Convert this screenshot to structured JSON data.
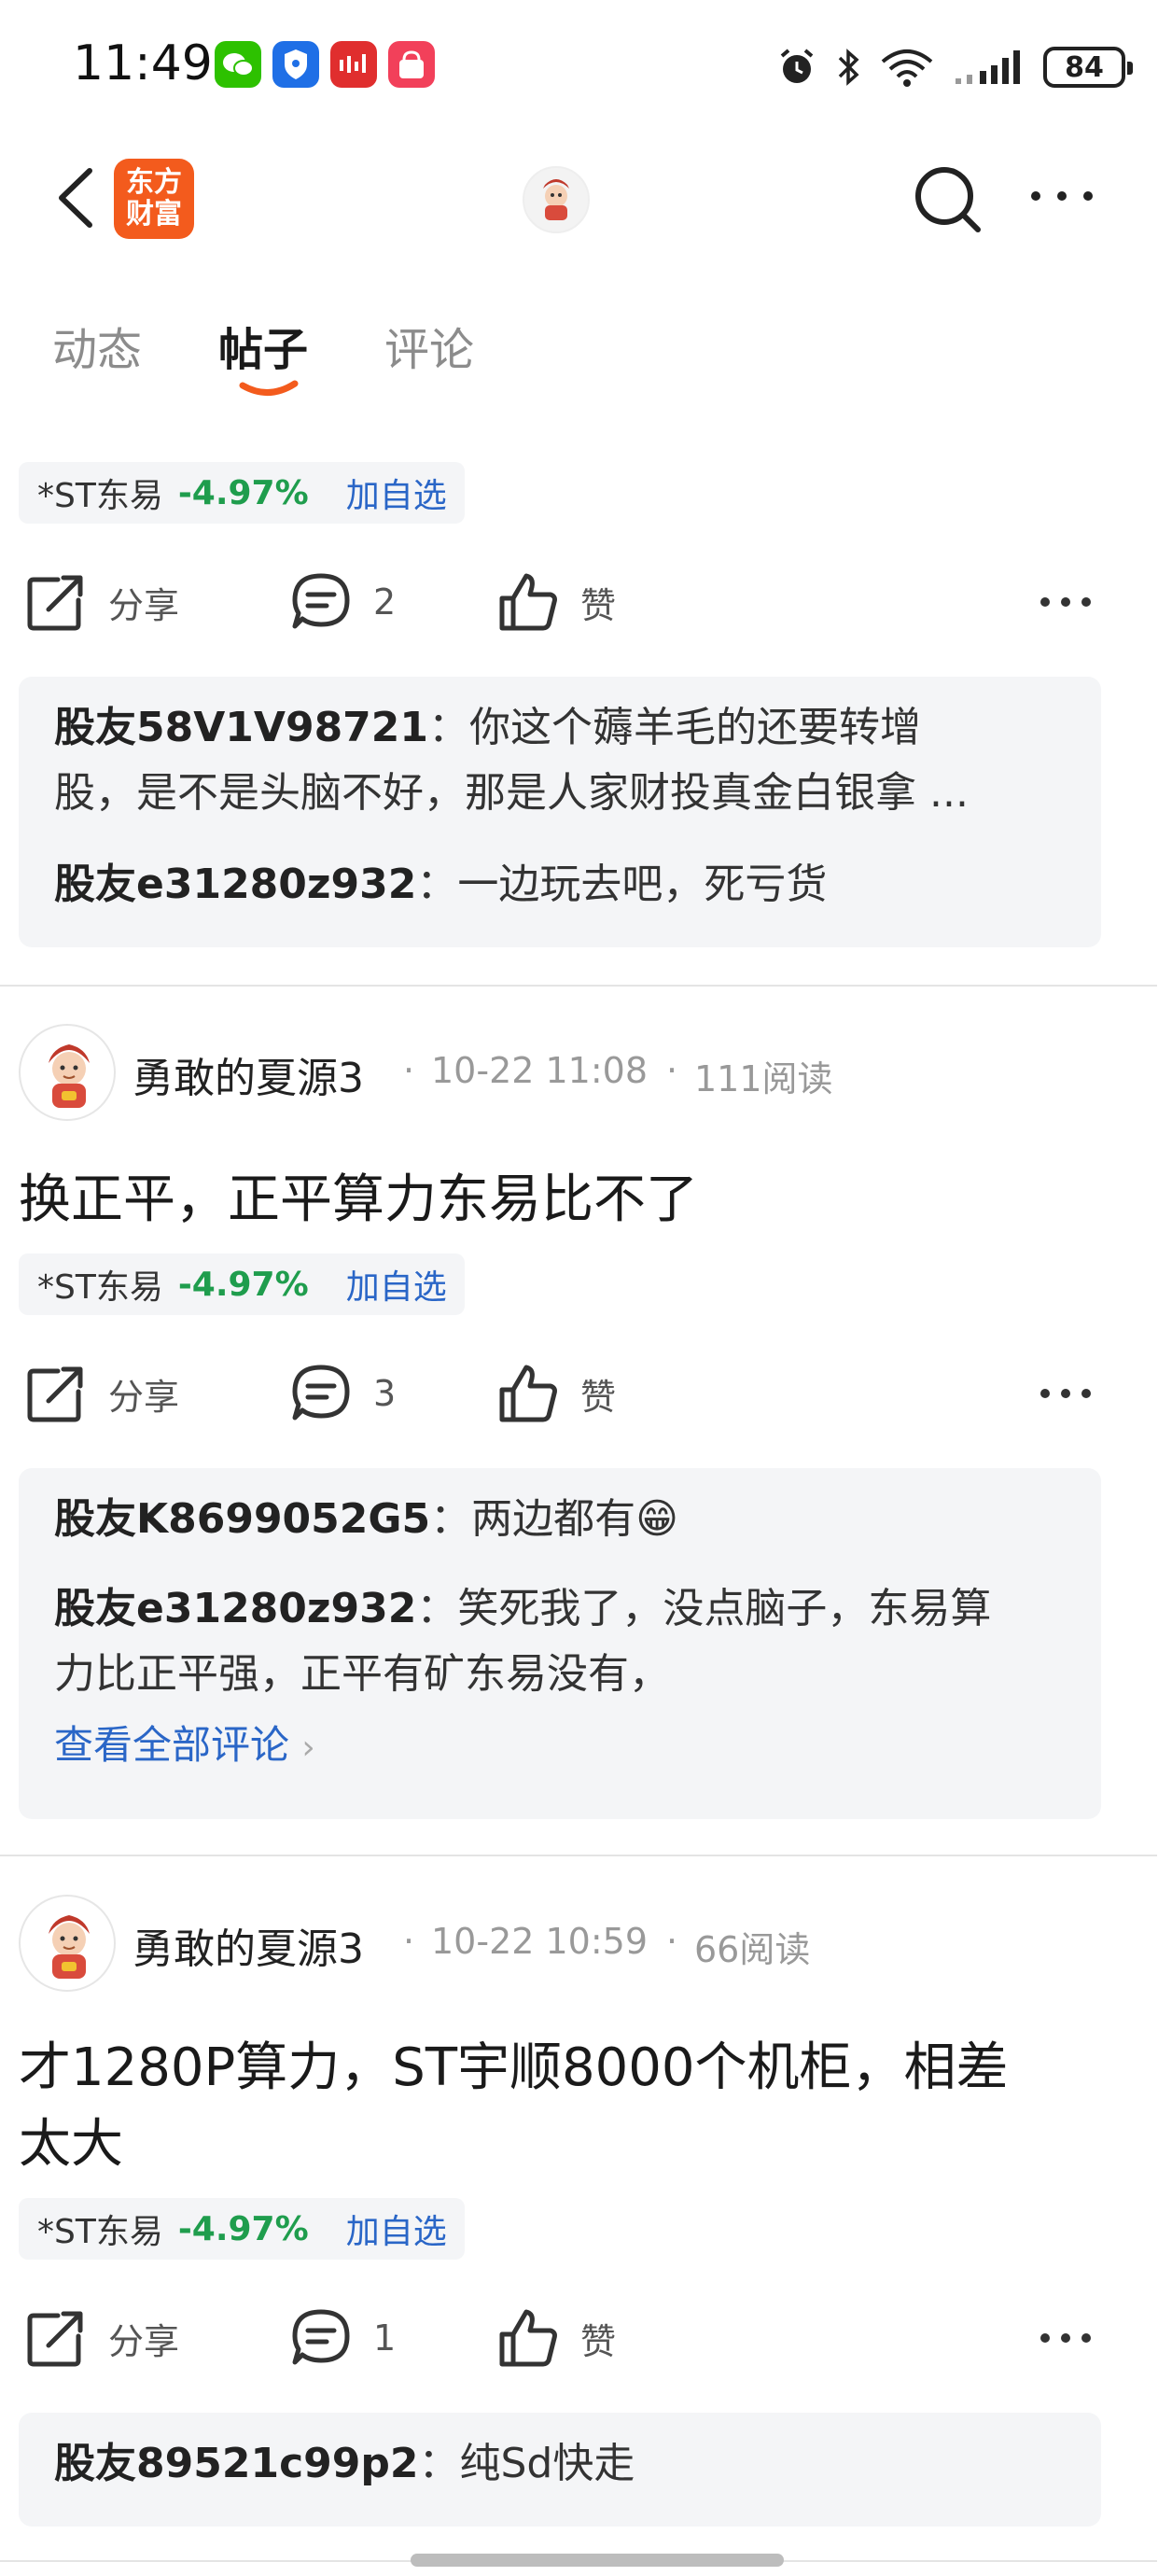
{
  "status_bar": {
    "time": "11:49",
    "battery": "84"
  },
  "nav": {
    "logo_line1": "东方",
    "logo_line2": "财富"
  },
  "tabs": [
    {
      "label": "动态",
      "active": false
    },
    {
      "label": "帖子",
      "active": true
    },
    {
      "label": "评论",
      "active": false
    }
  ],
  "colors": {
    "accent": "#f35b1d",
    "rise_green": "#1f9d4d",
    "link_blue": "#2a66c7"
  },
  "posts": [
    {
      "stock": {
        "name": "*ST东易",
        "change": "-4.97%",
        "add_label": "加自选"
      },
      "actions": {
        "share": "分享",
        "comments": "2",
        "like": "赞"
      },
      "comments": [
        {
          "user": "股友58V1V98721",
          "text_line1": "你这个薅羊毛的还要转增",
          "text_line2": "股，是不是头脑不好，那是人家财投真金白银拿 ..."
        },
        {
          "user": "股友e31280z932",
          "text": "一边玩去吧，死亏货"
        }
      ]
    },
    {
      "author": "勇敢的夏源3",
      "time": "10-22 11:08",
      "reads": "111阅读",
      "title": "换正平，正平算力东易比不了",
      "stock": {
        "name": "*ST东易",
        "change": "-4.97%",
        "add_label": "加自选"
      },
      "actions": {
        "share": "分享",
        "comments": "3",
        "like": "赞"
      },
      "comments": [
        {
          "user": "股友K8699052G5",
          "text": "两边都有😁"
        },
        {
          "user": "股友e31280z932",
          "text_line1": "笑死我了，没点脑子，东易算",
          "text_line2": "力比正平强，正平有矿东易没有，"
        }
      ],
      "see_all": "查看全部评论"
    },
    {
      "author": "勇敢的夏源3",
      "time": "10-22 10:59",
      "reads": "66阅读",
      "title_line1": "才1280P算力，ST宇顺8000个机柜，相差",
      "title_line2": "太大",
      "stock": {
        "name": "*ST东易",
        "change": "-4.97%",
        "add_label": "加自选"
      },
      "actions": {
        "share": "分享",
        "comments": "1",
        "like": "赞"
      },
      "comments": [
        {
          "user": "股友89521c99p2",
          "text": "纯Sd快走"
        }
      ]
    }
  ]
}
